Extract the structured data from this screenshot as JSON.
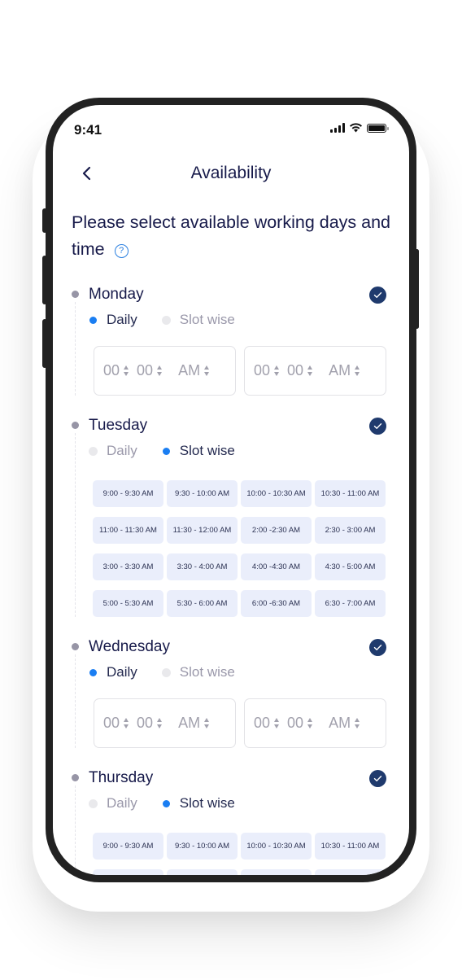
{
  "status_bar": {
    "time": "9:41",
    "icons": [
      "signal-icon",
      "wifi-icon",
      "battery-icon"
    ]
  },
  "header": {
    "title": "Availability",
    "back_icon": "chevron-left-icon"
  },
  "intro": {
    "text": "Please select available working days and time",
    "help_icon": "question-circle-icon"
  },
  "colors": {
    "primary_text": "#171a4a",
    "accent": "#1a7ef2",
    "check": "#1f3a6d",
    "slot_bg": "#eaeefb"
  },
  "options": {
    "daily": "Daily",
    "slot": "Slot wise"
  },
  "time_placeholder": {
    "hour": "00",
    "minute": "00",
    "period": "AM"
  },
  "days": [
    {
      "name": "Monday",
      "checked": true,
      "mode": "daily"
    },
    {
      "name": "Tuesday",
      "checked": true,
      "mode": "slot",
      "slots": [
        "9:00 - 9:30 AM",
        "9:30 - 10:00 AM",
        "10:00 - 10:30 AM",
        "10:30 - 11:00 AM",
        "11:00 - 11:30 AM",
        "11:30 - 12:00 AM",
        "2:00 -2:30 AM",
        "2:30 - 3:00 AM",
        "3:00 - 3:30 AM",
        "3:30 - 4:00 AM",
        "4:00 -4:30 AM",
        "4:30 - 5:00 AM",
        "5:00 - 5:30 AM",
        "5:30 - 6:00 AM",
        "6:00 -6:30 AM",
        "6:30 - 7:00 AM"
      ]
    },
    {
      "name": "Wednesday",
      "checked": true,
      "mode": "daily"
    },
    {
      "name": "Thursday",
      "checked": true,
      "mode": "slot",
      "slots": [
        "9:00 - 9:30 AM",
        "9:30 - 10:00 AM",
        "10:00 - 10:30 AM",
        "10:30 - 11:00 AM",
        "",
        "",
        "",
        ""
      ]
    }
  ]
}
